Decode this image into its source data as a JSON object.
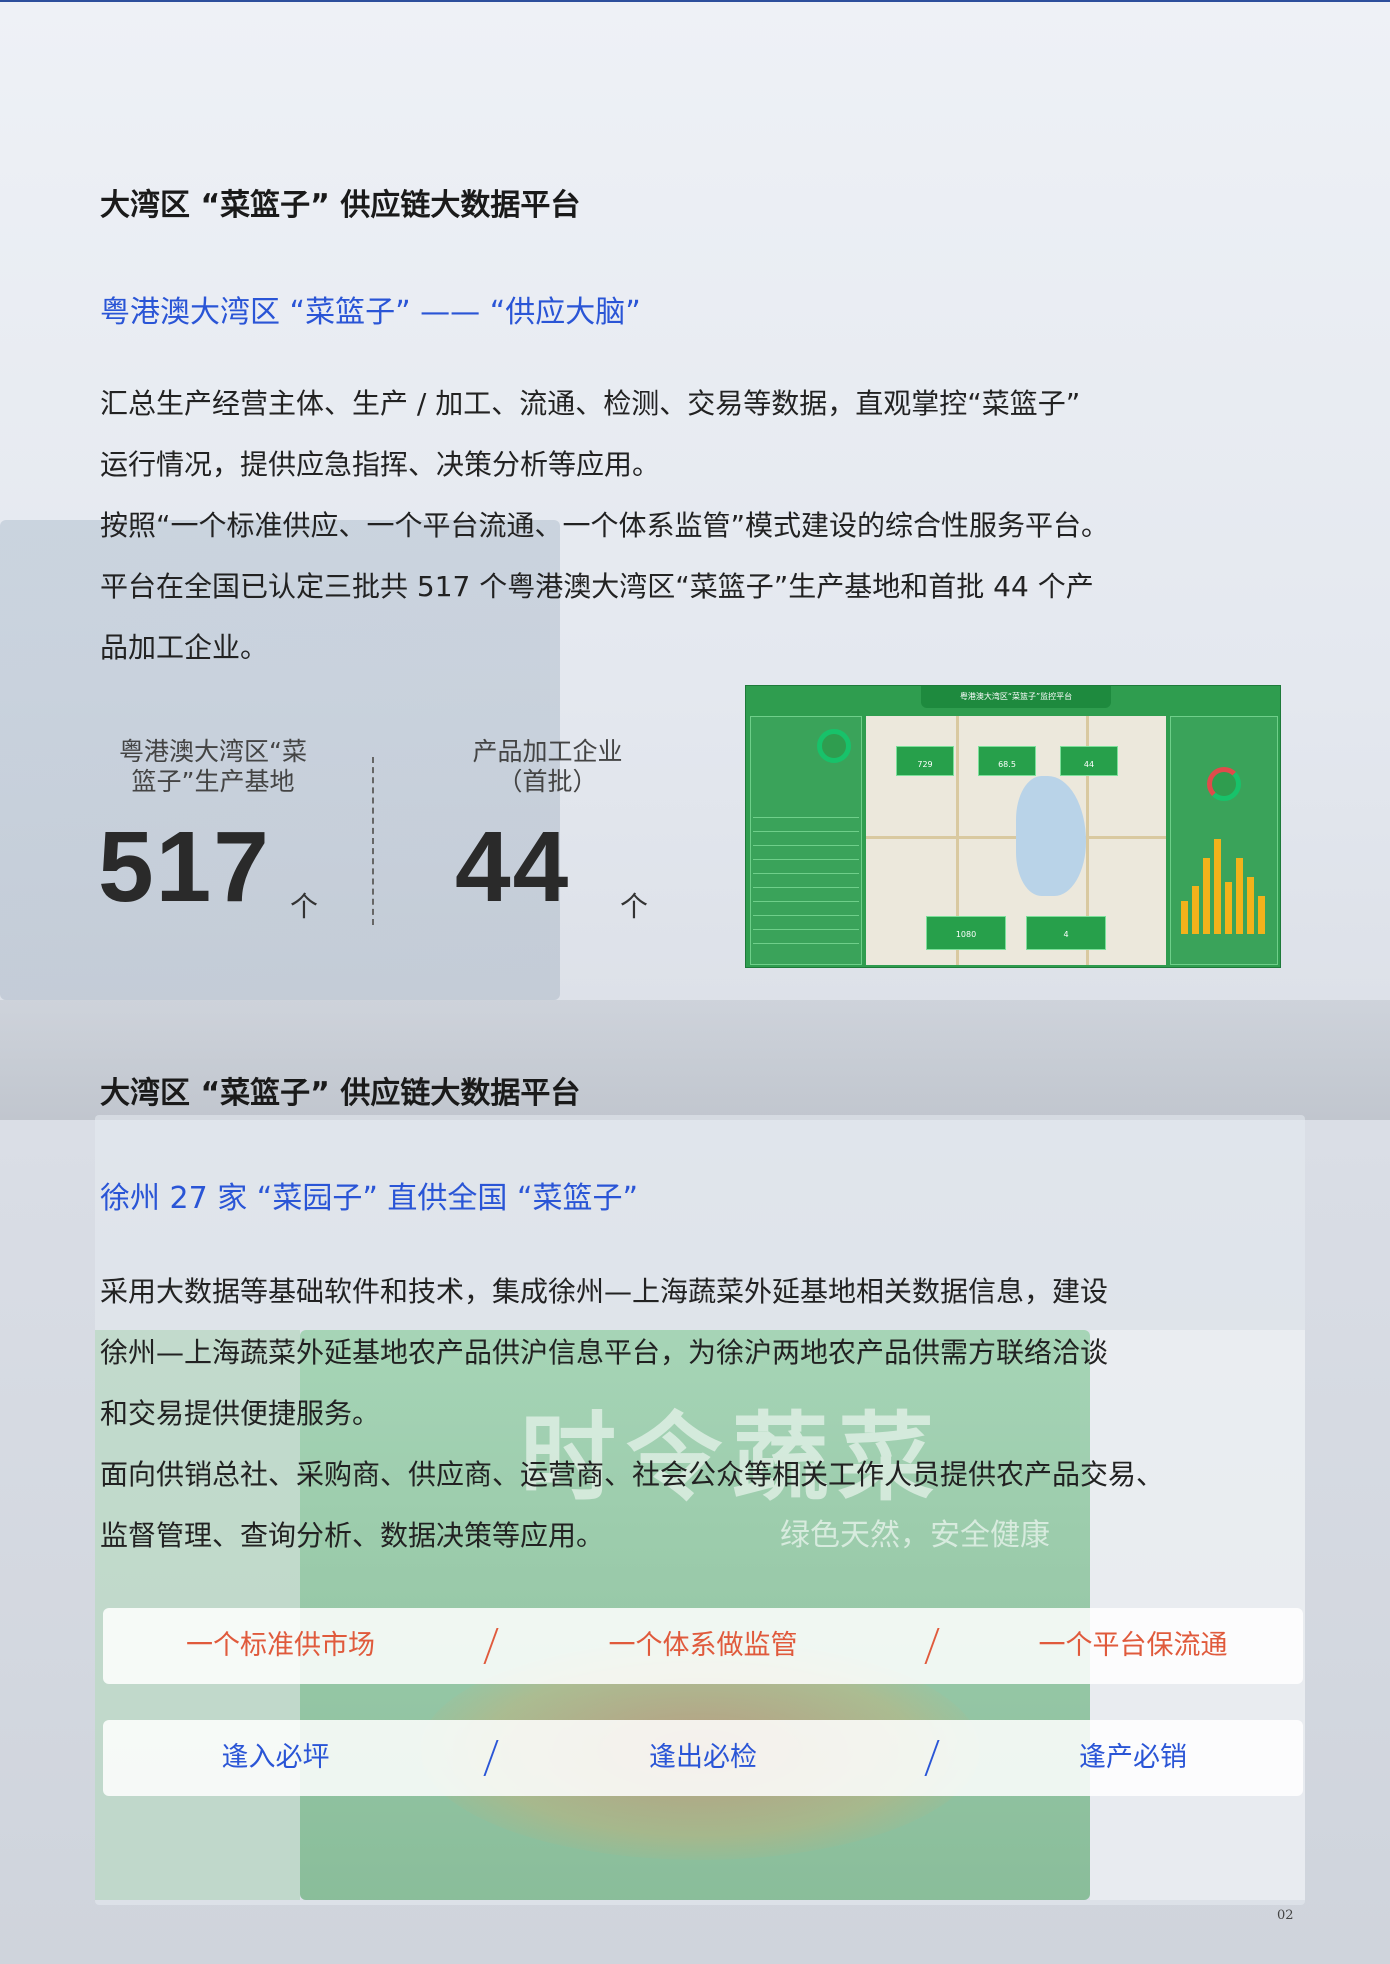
{
  "section1": {
    "title": "大湾区 “菜篮子” 供应链大数据平台",
    "subtitle": "粤港澳大湾区 “菜篮子” —— “供应大脑”",
    "paragraphs": [
      "汇总生产经营主体、生产 / 加工、流通、检测、交易等数据，直观掌控“菜篮子”\n运行情况，提供应急指挥、决策分析等应用。",
      "按照“一个标准供应、一个平台流通、一个体系监管”模式建设的综合性服务平台。",
      "平台在全国已认定三批共 517 个粤港澳大湾区“菜篮子”生产基地和首批 44 个产\n品加工企业。"
    ],
    "stats": [
      {
        "label": "粤港澳大湾区“菜\n篮子”生产基地",
        "value": "517",
        "unit": "个"
      },
      {
        "label": "产品加工企业\n（首批）",
        "value": "44",
        "unit": "个"
      }
    ],
    "dashboard": {
      "title": "粤港澳大湾区“菜篮子”监控平台",
      "cards": [
        "729",
        "68.5",
        "44"
      ],
      "bottom_cards": [
        "1080",
        "4"
      ],
      "bars": [
        0.35,
        0.5,
        0.8,
        1.0,
        0.55,
        0.8,
        0.6,
        0.4
      ]
    }
  },
  "section2": {
    "title": "大湾区 “菜篮子” 供应链大数据平台",
    "subtitle": "徐州 27 家 “菜园子” 直供全国 “菜篮子”",
    "paragraphs": [
      "采用大数据等基础软件和技术，集成徐州—上海蔬菜外延基地相关数据信息，建设\n徐州—上海蔬菜外延基地农产品供沪信息平台，为徐沪两地农产品供需方联络洽谈\n和交易提供便捷服务。",
      "面向供销总社、采购商、供应商、运营商、社会公众等相关工作人员提供农产品交易、\n监督管理、查询分析、数据决策等应用。"
    ],
    "pillars_top": [
      "一个标准供市场",
      "一个体系做监管",
      "一个平台保流通"
    ],
    "pillars_bottom": [
      "逢入必坪",
      "逢出必检",
      "逢产必销"
    ],
    "background_banner": "时令蔬菜",
    "background_banner_sub": "绿色天然，安全健康"
  },
  "page_number": "02",
  "colors": {
    "accent_blue": "#2a55d6",
    "accent_orange": "#e05a3c",
    "dashboard_green": "#2f9d4f"
  }
}
